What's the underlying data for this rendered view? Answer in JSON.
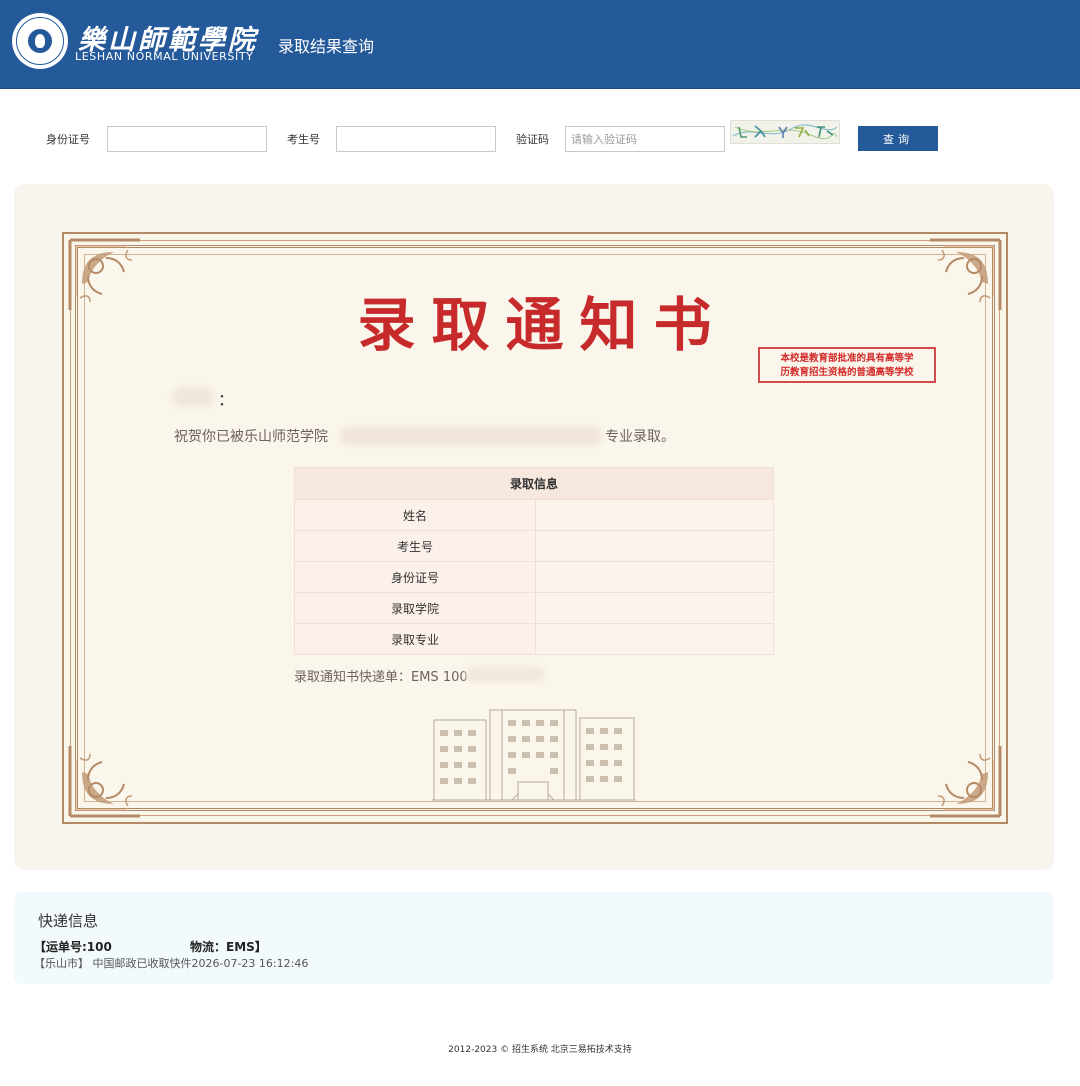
{
  "header": {
    "university_cn": "樂山師範學院",
    "university_en": "LESHAN NORMAL UNIVERSITY",
    "page_title": "录取结果查询",
    "brand_color": "#24599a"
  },
  "query": {
    "id_label": "身份证号",
    "id_value": "",
    "exam_label": "考生号",
    "exam_value": "",
    "captcha_label": "验证码",
    "captcha_placeholder": "请输入验证码",
    "button_label": "查询"
  },
  "certificate": {
    "title": "录取通知书",
    "stamp_line1": "本校是教育部批准的具有高等学",
    "stamp_line2": "历教育招生资格的普通高等学校",
    "name_colon": "：",
    "congrats_prefix": "祝贺你已被乐山师范学院",
    "congrats_suffix": "专业录取。",
    "table": {
      "header": "录取信息",
      "rows": [
        {
          "label": "姓名",
          "value": ""
        },
        {
          "label": "考生号",
          "value": ""
        },
        {
          "label": "身份证号",
          "value": ""
        },
        {
          "label": "录取学院",
          "value": ""
        },
        {
          "label": "录取专业",
          "value": ""
        }
      ]
    },
    "express_line": "录取通知书快递单：EMS 100",
    "accent_color": "#c62a2a",
    "frame_color": "#b48a66"
  },
  "courier": {
    "title": "快递信息",
    "tracking": "【运单号:100",
    "carrier": "物流：EMS】",
    "log": "【乐山市】 中国邮政已收取快件2026-07-23 16:12:46"
  },
  "footer": {
    "text": "2012-2023 © 招生系统 北京三易拓技术支持"
  }
}
